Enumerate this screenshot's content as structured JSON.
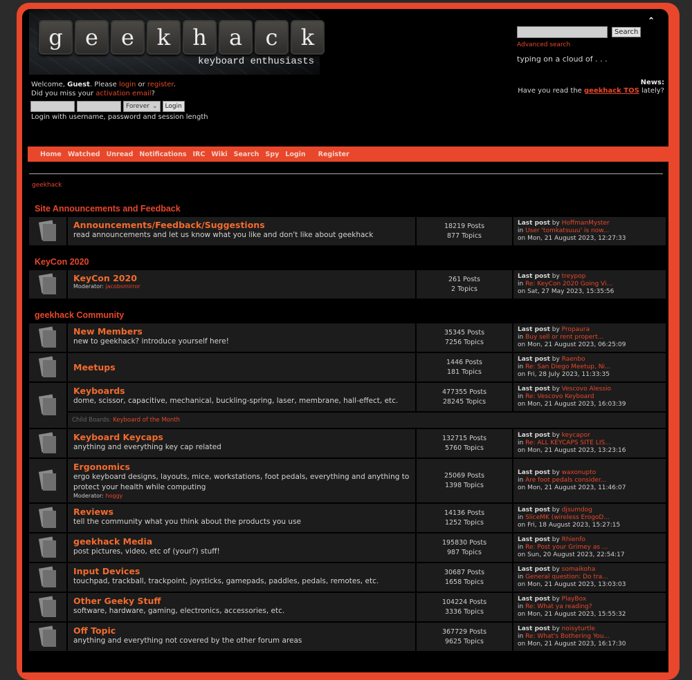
{
  "header": {
    "logo_letters": [
      "g",
      "e",
      "e",
      "k",
      "h",
      "a",
      "c",
      "k"
    ],
    "tagline": "keyboard enthusiasts",
    "welcome_prefix": "Welcome, ",
    "guest": "Guest",
    "please": ". Please ",
    "login_link": "login",
    "or": " or ",
    "register_link": "register",
    "period": ".",
    "miss_prefix": "Did you miss your ",
    "activation_link": "activation email",
    "miss_suffix": "?",
    "session_option": "Forever",
    "login_button": "Login",
    "login_hint": "Login with username, password and session length",
    "search_button": "Search",
    "advanced_search": "Advanced search",
    "slogan": "typing on a cloud of . . .",
    "news_label": "News:",
    "news_prefix": "Have you read the ",
    "news_link": "geekhack TOS",
    "news_suffix": " lately?"
  },
  "nav": [
    "Home",
    "Watched",
    "Unread",
    "Notifications",
    "IRC",
    "Wiki",
    "Search",
    "Spy",
    "Login",
    "Register"
  ],
  "breadcrumb": "geekhack",
  "colors": {
    "accent": "#e8472b",
    "board_title": "#f26b2e",
    "row_bg": "#1c1c1c"
  },
  "categories": [
    {
      "title": "Site Announcements and Feedback",
      "boards": [
        {
          "name": "Announcements/Feedback/Suggestions",
          "desc": "read announcements and let us know what you like and don't like about geekhack",
          "posts": "18219 Posts",
          "topics": "877 Topics",
          "last_by": "HoffmanMyster",
          "last_in": "User 'tomkatsuuu' is now...",
          "last_on": "on Mon, 21 August 2023, 12:27:33"
        }
      ]
    },
    {
      "title": "KeyCon 2020",
      "boards": [
        {
          "name": "KeyCon 2020",
          "moderator_label": "Moderator: ",
          "moderator": "jacobsmirror",
          "posts": "261 Posts",
          "topics": "2 Topics",
          "last_by": "treypop",
          "last_in": "Re: KeyCon 2020 Going Vi...",
          "last_on": "on Sat, 27 May 2023, 15:35:56"
        }
      ]
    },
    {
      "title": "geekhack Community",
      "boards": [
        {
          "name": "New Members",
          "desc": "new to geekhack? introduce yourself here!",
          "posts": "35345 Posts",
          "topics": "7256 Topics",
          "last_by": "Propaura",
          "last_in": "Buy sell or rent propert...",
          "last_on": "on Mon, 21 August 2023, 06:25:09"
        },
        {
          "name": "Meetups",
          "posts": "1446 Posts",
          "topics": "181 Topics",
          "last_by": "Raenbo",
          "last_in": "Re: San Diego Meetup, Ni...",
          "last_on": "on Fri, 28 July 2023, 11:33:35"
        },
        {
          "name": "Keyboards",
          "desc": "dome, scissor, capacitive, mechanical, buckling-spring, laser, membrane, hall-effect, etc.",
          "posts": "477355 Posts",
          "topics": "28245 Topics",
          "last_by": "Vescovo Alessio",
          "last_in": "Re: Vescovo Keyboard",
          "last_on": "on Mon, 21 August 2023, 16:03:39",
          "child_label": "Child Boards: ",
          "child": "Keyboard of the Month"
        },
        {
          "name": "Keyboard Keycaps",
          "desc": "anything and everything key cap related",
          "posts": "132715 Posts",
          "topics": "5760 Topics",
          "last_by": "keycapor",
          "last_in": "Re: ALL KEYCAPS SITE LIS...",
          "last_on": "on Mon, 21 August 2023, 13:23:16"
        },
        {
          "name": "Ergonomics",
          "desc": "ergo keyboard designs, layouts, mice, workstations, foot pedals, everything and anything to protect your health while computing",
          "moderator_label": "Moderator: ",
          "moderator": "hoggy",
          "posts": "25069 Posts",
          "topics": "1398 Topics",
          "last_by": "waxonupto",
          "last_in": "Are foot pedals consider...",
          "last_on": "on Mon, 21 August 2023, 11:46:07"
        },
        {
          "name": "Reviews",
          "desc": "tell the community what you think about the products you use",
          "posts": "14136 Posts",
          "topics": "1252 Topics",
          "last_by": "djsumdog",
          "last_in": "SliceMK (wireless ErogoD...",
          "last_on": "on Fri, 18 August 2023, 15:27:15"
        },
        {
          "name": "geekhack Media",
          "desc": "post pictures, video, etc of (your?) stuff!",
          "posts": "195830 Posts",
          "topics": "987 Topics",
          "last_by": "Rhienfo",
          "last_in": "Re: Post your Grimey as ...",
          "last_on": "on Sun, 20 August 2023, 22:54:17"
        },
        {
          "name": "Input Devices",
          "desc": "touchpad, trackball, trackpoint, joysticks, gamepads, paddles, pedals, remotes, etc.",
          "posts": "30687 Posts",
          "topics": "1658 Topics",
          "last_by": "somaikoha",
          "last_in": "General question: Do tra...",
          "last_on": "on Mon, 21 August 2023, 13:03:03"
        },
        {
          "name": "Other Geeky Stuff",
          "desc": "software, hardware, gaming, electronics, accessories, etc.",
          "posts": "104224 Posts",
          "topics": "3336 Topics",
          "last_by": "PlayBox",
          "last_in": "Re: What ya reading?",
          "last_on": "on Mon, 21 August 2023, 15:55:32"
        },
        {
          "name": "Off Topic",
          "desc": "anything and everything not covered by the other forum areas",
          "posts": "367729 Posts",
          "topics": "9625 Topics",
          "last_by": "noisyturtle",
          "last_in": "Re: What's Bothering You...",
          "last_on": "on Mon, 21 August 2023, 16:17:30"
        }
      ]
    }
  ],
  "last_post_label": "Last post",
  "by": " by ",
  "in": "in "
}
